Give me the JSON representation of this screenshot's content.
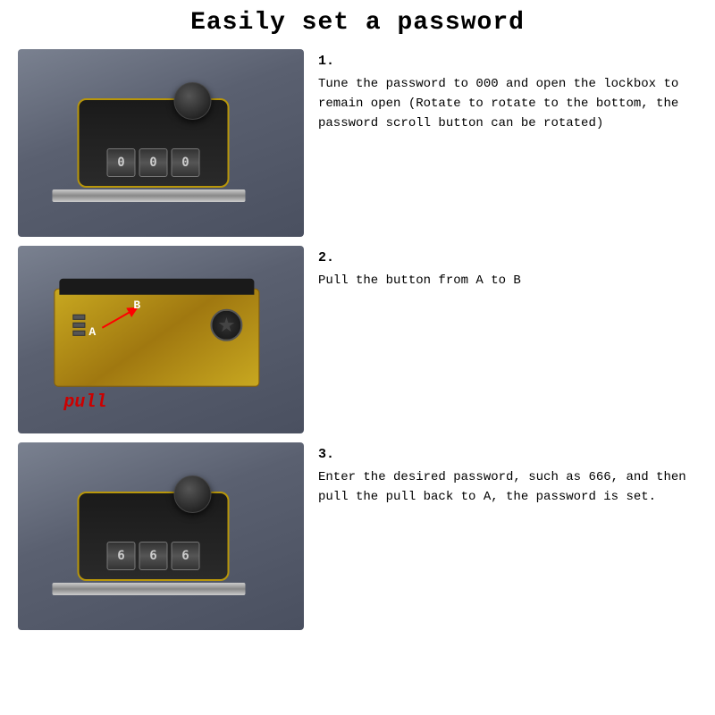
{
  "title": "Easily set a password",
  "steps": [
    {
      "number": "1.",
      "text": "Tune the password to 000 and open the lockbox to remain open (Rotate to rotate to the bottom, the password scroll button can be rotated)",
      "digits": [
        "0",
        "0",
        "0"
      ]
    },
    {
      "number": "2.",
      "text": "Pull the button from A to B",
      "label_pull": "pull",
      "label_a": "A",
      "label_b": "B"
    },
    {
      "number": "3.",
      "text": "Enter the desired password, such as 666, and then pull the pull back to A,  the password is set.",
      "digits": [
        "6",
        "6",
        "6"
      ]
    }
  ]
}
